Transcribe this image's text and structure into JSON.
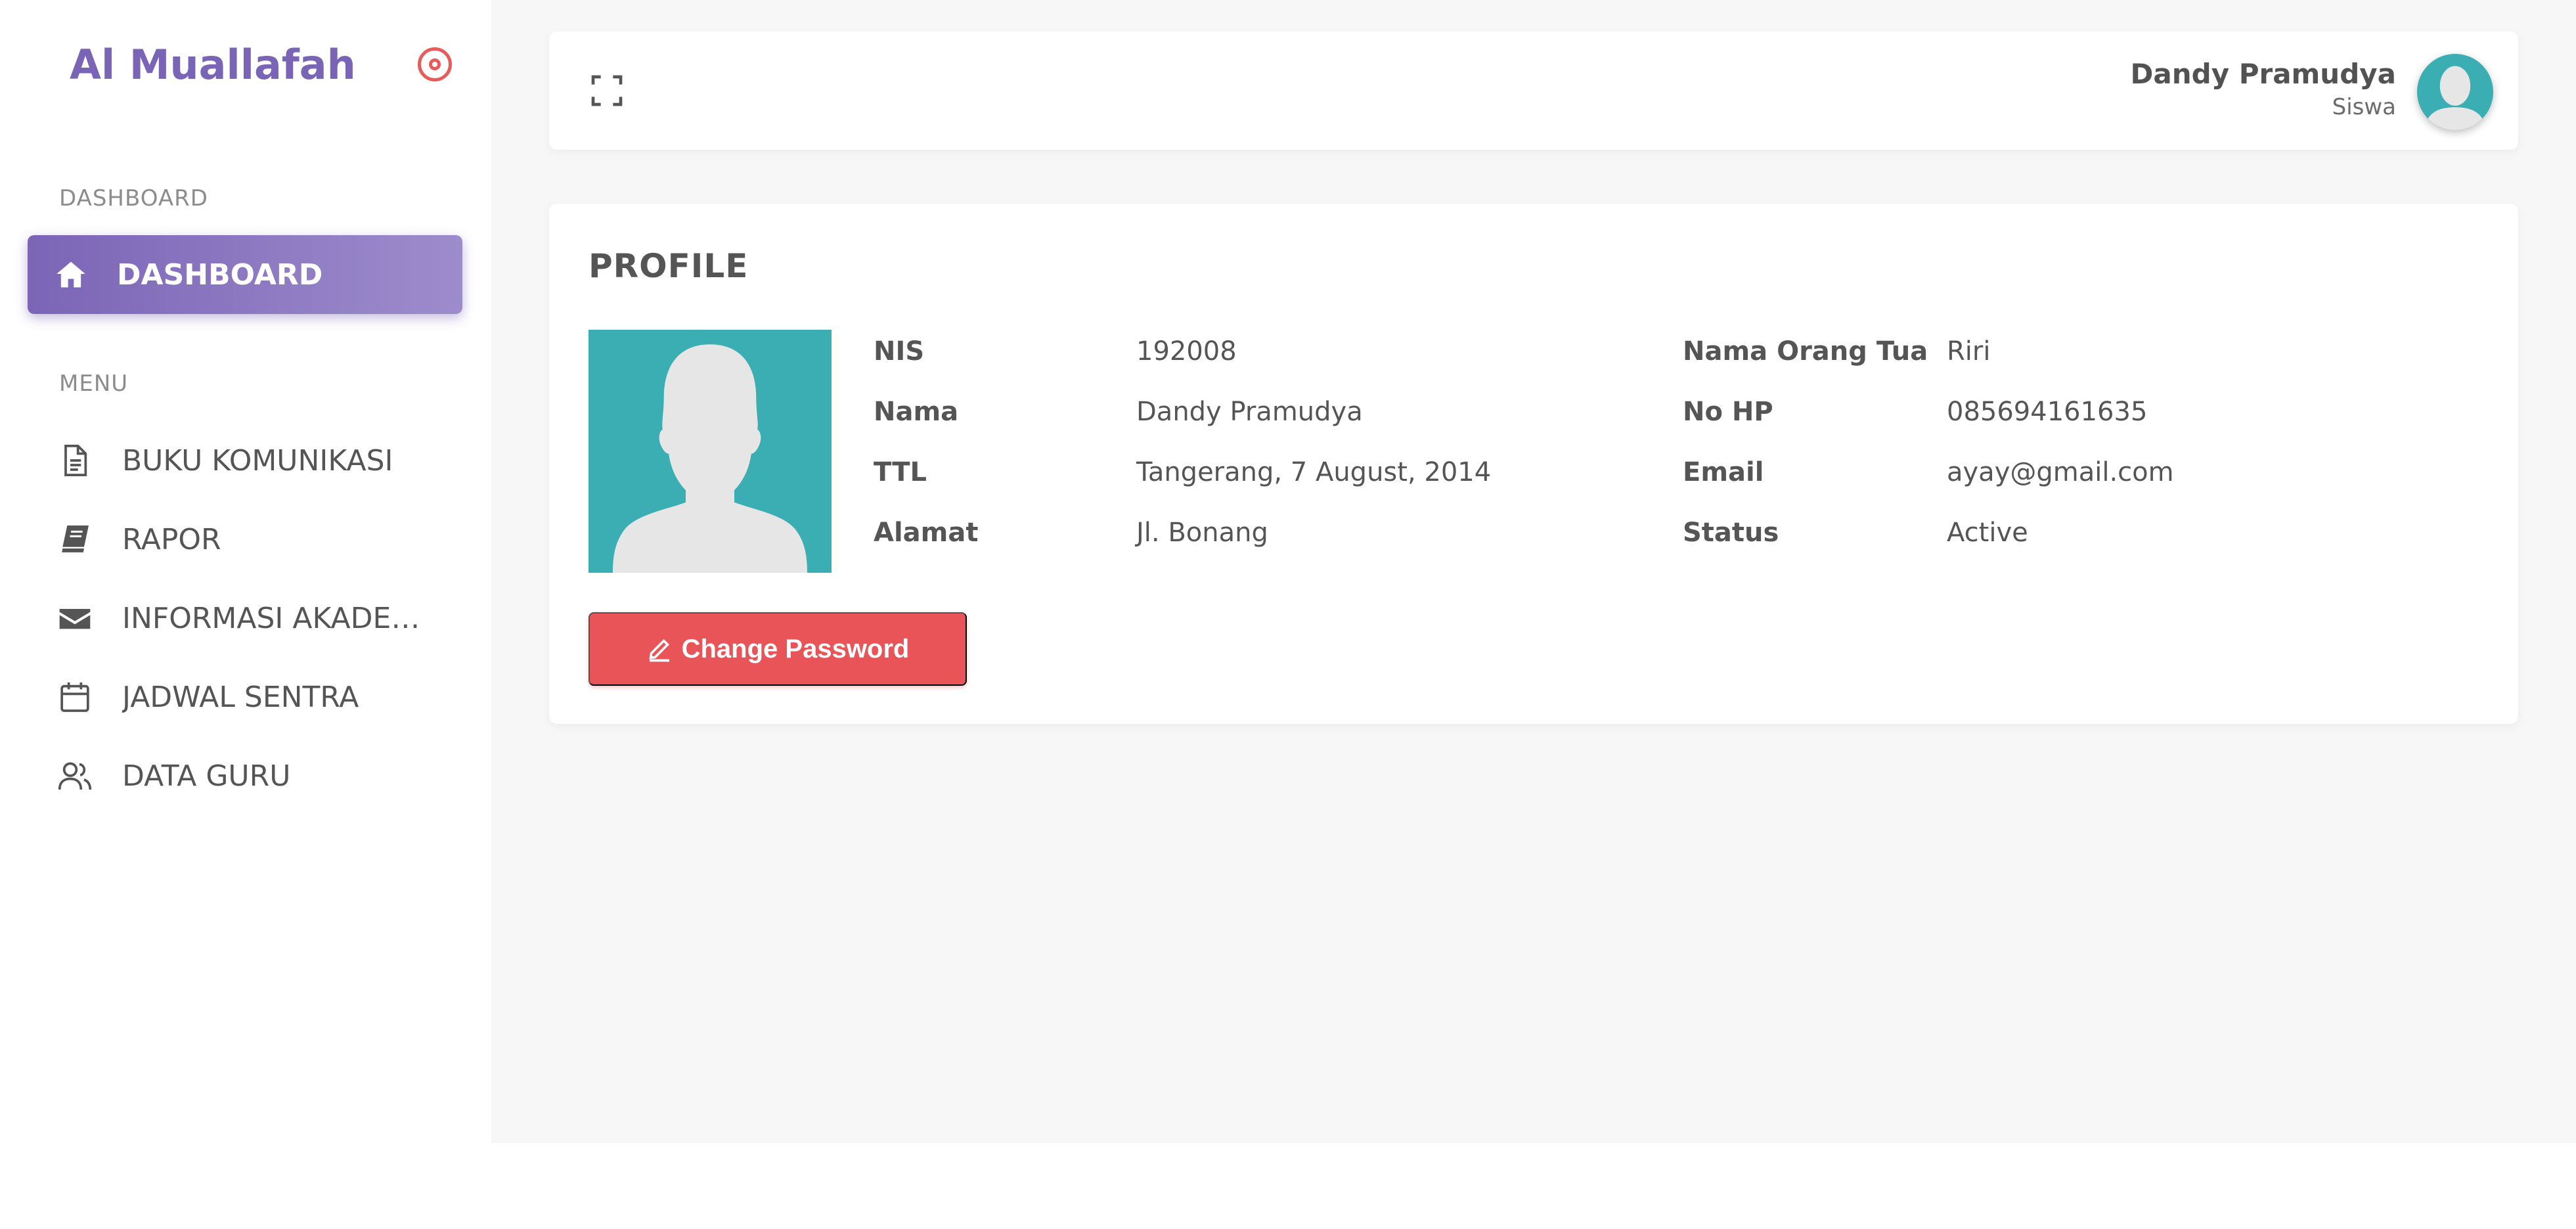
{
  "brand": {
    "name": "Al Muallafah"
  },
  "sidebar": {
    "section_dashboard": "DASHBOARD",
    "active_item": {
      "label": "DASHBOARD",
      "icon": "home-icon"
    },
    "section_menu": "MENU",
    "items": [
      {
        "label": "BUKU KOMUNIKASI",
        "icon": "document-icon"
      },
      {
        "label": "RAPOR",
        "icon": "book-icon"
      },
      {
        "label": "INFORMASI AKADEMIK",
        "icon": "envelope-icon"
      },
      {
        "label": "JADWAL SENTRA",
        "icon": "calendar-icon"
      },
      {
        "label": "DATA GURU",
        "icon": "users-icon"
      }
    ]
  },
  "header": {
    "user_name": "Dandy Pramudya",
    "user_role": "Siswa"
  },
  "profile": {
    "title": "PROFILE",
    "left_fields": [
      {
        "label": "NIS",
        "value": "192008"
      },
      {
        "label": "Nama",
        "value": "Dandy Pramudya"
      },
      {
        "label": "TTL",
        "value": "Tangerang, 7 August, 2014"
      },
      {
        "label": "Alamat",
        "value": "Jl. Bonang"
      }
    ],
    "right_fields": [
      {
        "label": "Nama Orang Tua",
        "value": "Riri"
      },
      {
        "label": "No HP",
        "value": "085694161635"
      },
      {
        "label": "Email",
        "value": "ayay@gmail.com"
      },
      {
        "label": "Status",
        "value": "Active"
      }
    ],
    "change_password_label": "Change Password"
  },
  "colors": {
    "brand": "#7a64b6",
    "accent_danger": "#e85457",
    "avatar_bg": "#3aaeb2"
  }
}
